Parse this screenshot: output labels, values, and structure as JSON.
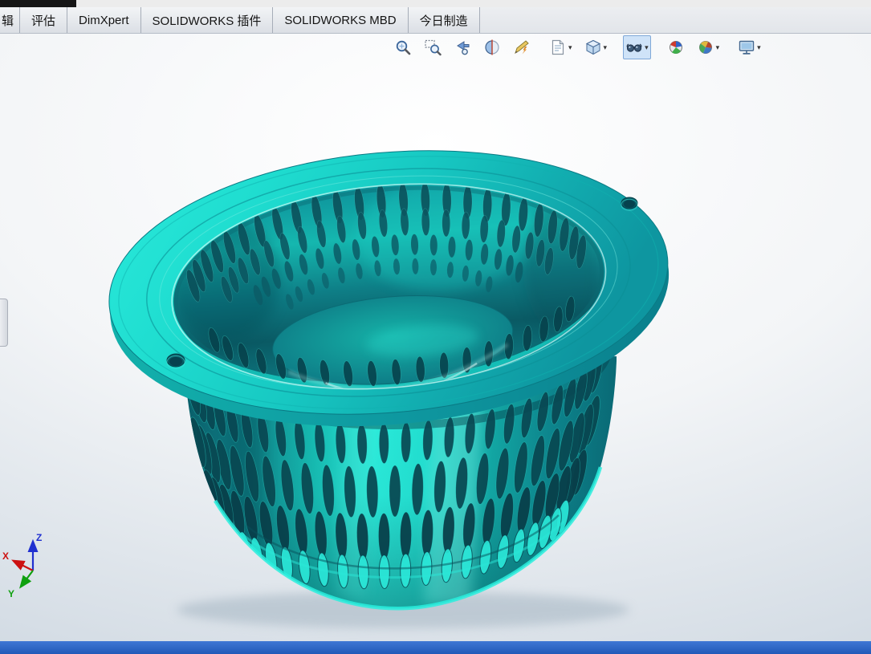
{
  "tabs": {
    "items": [
      {
        "label": "辑"
      },
      {
        "label": "评估"
      },
      {
        "label": "DimXpert"
      },
      {
        "label": "SOLIDWORKS 插件"
      },
      {
        "label": "SOLIDWORKS MBD"
      },
      {
        "label": "今日制造"
      }
    ]
  },
  "toolbar": {
    "items": [
      {
        "name": "zoom-to-fit"
      },
      {
        "name": "zoom-to-area"
      },
      {
        "name": "previous-view"
      },
      {
        "name": "section-view"
      },
      {
        "name": "3d-drawing-view"
      },
      {
        "name": "view-orientation",
        "dropdown": true
      },
      {
        "name": "display-style",
        "dropdown": true
      },
      {
        "name": "hide-show-items",
        "dropdown": true,
        "active": true
      },
      {
        "name": "edit-appearance"
      },
      {
        "name": "apply-scene",
        "dropdown": true
      },
      {
        "name": "view-settings",
        "dropdown": true
      }
    ]
  },
  "triad": {
    "x_label": "X",
    "y_label": "Y",
    "z_label": "Z"
  },
  "colors": {
    "model_accent": "#1fe3d4",
    "model_dark": "#0a5560",
    "status_bar": "#2b66c6",
    "triad_x": "#cc1111",
    "triad_y": "#0fa00f",
    "triad_z": "#2030d0"
  },
  "status_bar": {
    "text": ""
  }
}
